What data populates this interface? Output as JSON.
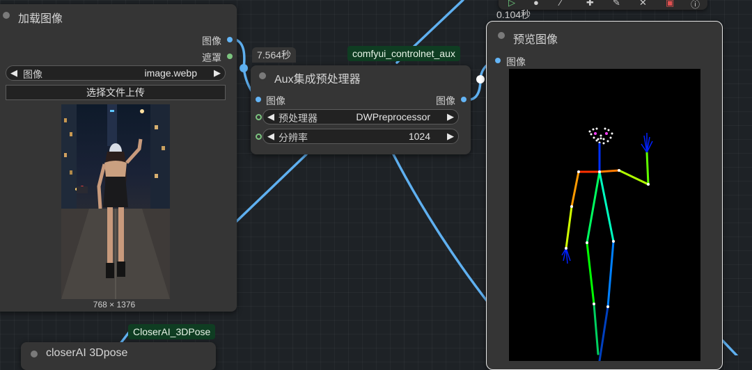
{
  "canvas": {
    "background": "#1e2226",
    "wire_color": "#5fb0f0"
  },
  "toolbar": {
    "icons": [
      "play-icon",
      "circle-icon",
      "edit-icon",
      "pin-icon",
      "pencil-icon",
      "bypass-icon",
      "delete-icon",
      "info-icon"
    ],
    "glyphs": [
      "▷",
      "●",
      "⁄",
      "✚",
      "✎",
      "✕",
      "▣",
      "ⓘ"
    ]
  },
  "load_image_node": {
    "title": "加载图像",
    "outputs": [
      {
        "label": "图像",
        "type": "image",
        "color": "#64b5f6"
      },
      {
        "label": "遮罩",
        "type": "mask",
        "color": "#7cc47f"
      }
    ],
    "image_widget": {
      "label": "图像",
      "value": "image.webp"
    },
    "upload_button": "选择文件上传",
    "image_size": "768 × 1376"
  },
  "aux_node": {
    "time": "7.564秒",
    "badge": "comfyui_controlnet_aux",
    "title": "Aux集成预处理器",
    "input": {
      "label": "图像"
    },
    "output": {
      "label": "图像"
    },
    "widgets": [
      {
        "label": "预处理器",
        "value": "DWPreprocessor"
      },
      {
        "label": "分辨率",
        "value": "1024"
      }
    ]
  },
  "preview_node": {
    "time": "0.104秒",
    "title": "预览图像",
    "input": {
      "label": "图像"
    }
  },
  "closer_node": {
    "badge": "CloserAI_3DPose",
    "title": "closerAI 3Dpose"
  }
}
